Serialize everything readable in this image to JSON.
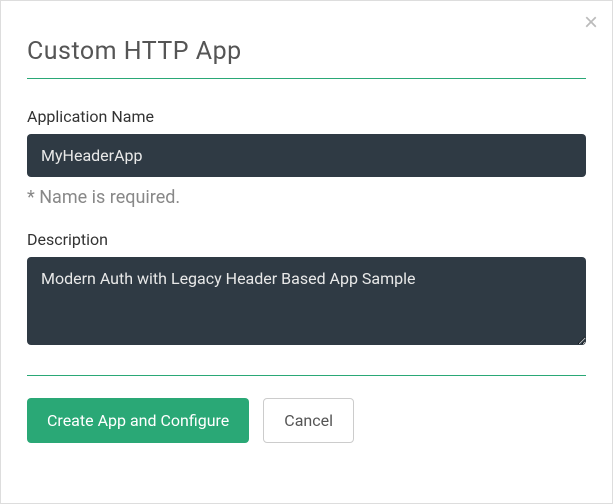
{
  "dialog": {
    "title": "Custom HTTP App",
    "close_icon": "×"
  },
  "fields": {
    "appName": {
      "label": "Application Name",
      "value": "MyHeaderApp",
      "hint": "* Name is required."
    },
    "description": {
      "label": "Description",
      "value": "Modern Auth with Legacy Header Based App Sample"
    }
  },
  "buttons": {
    "primary": "Create App and Configure",
    "secondary": "Cancel"
  }
}
